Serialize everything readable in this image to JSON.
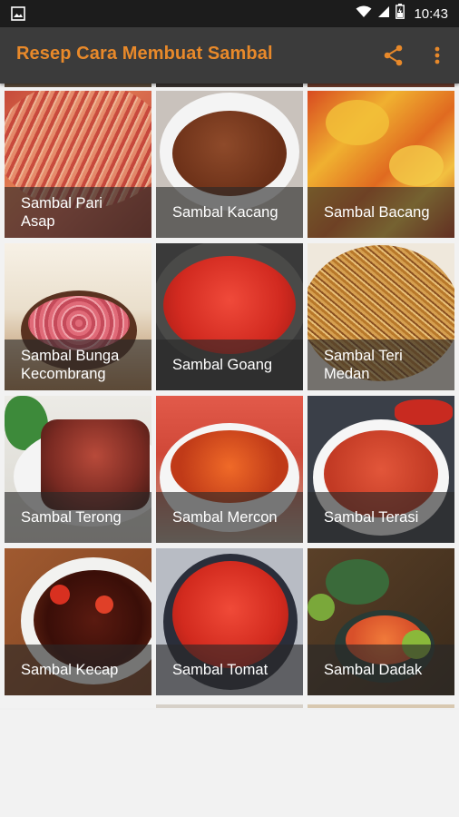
{
  "status": {
    "time": "10:43"
  },
  "app": {
    "title": "Resep Cara Membuat Sambal"
  },
  "icons": {
    "gallery": "image-icon",
    "wifi": "wifi-icon",
    "signal": "signal-icon",
    "battery": "battery-icon",
    "share": "share-icon",
    "more": "more-vert-icon"
  },
  "colors": {
    "title": "#e8892a",
    "app_bar": "#3b3b3b",
    "status_bar": "#1c1c1c"
  },
  "recipes": [
    {
      "label": "Sambal Pari Asap"
    },
    {
      "label": "Sambal Kacang"
    },
    {
      "label": "Sambal Bacang"
    },
    {
      "label": "Sambal Bunga Kecombrang"
    },
    {
      "label": "Sambal Goang"
    },
    {
      "label": "Sambal Teri Medan"
    },
    {
      "label": "Sambal Terong"
    },
    {
      "label": "Sambal Mercon"
    },
    {
      "label": "Sambal Terasi"
    },
    {
      "label": "Sambal Kecap"
    },
    {
      "label": "Sambal Tomat"
    },
    {
      "label": "Sambal Dadak"
    }
  ]
}
